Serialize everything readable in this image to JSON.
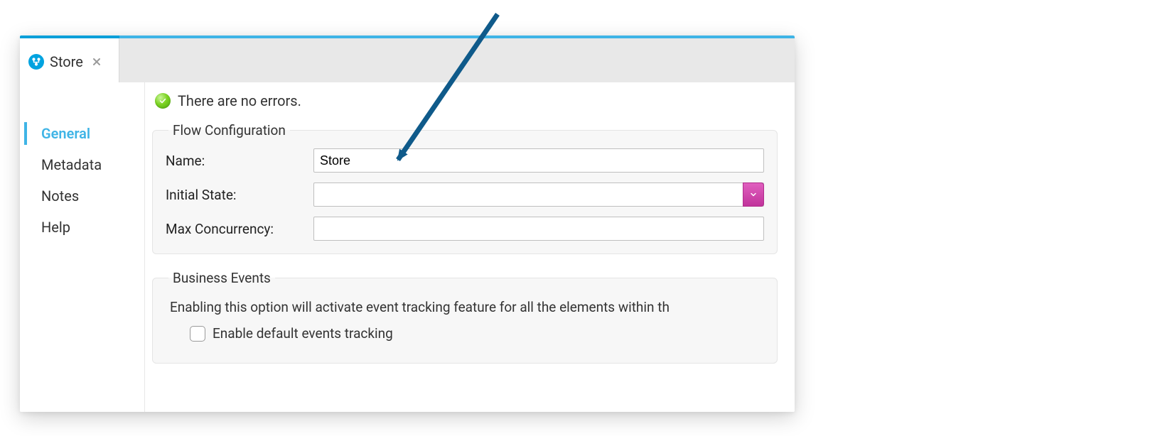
{
  "tab": {
    "title": "Store"
  },
  "sidebar": {
    "items": [
      {
        "label": "General",
        "active": true
      },
      {
        "label": "Metadata",
        "active": false
      },
      {
        "label": "Notes",
        "active": false
      },
      {
        "label": "Help",
        "active": false
      }
    ]
  },
  "status": {
    "message": "There are no errors."
  },
  "flow_config": {
    "legend": "Flow Configuration",
    "name_label": "Name:",
    "name_value": "Store",
    "initial_state_label": "Initial State:",
    "initial_state_value": "",
    "max_concurrency_label": "Max Concurrency:",
    "max_concurrency_value": ""
  },
  "business_events": {
    "legend": "Business Events",
    "description": "Enabling this option will activate event tracking feature for all the elements within th",
    "checkbox_label": "Enable default events tracking",
    "checkbox_checked": false
  }
}
